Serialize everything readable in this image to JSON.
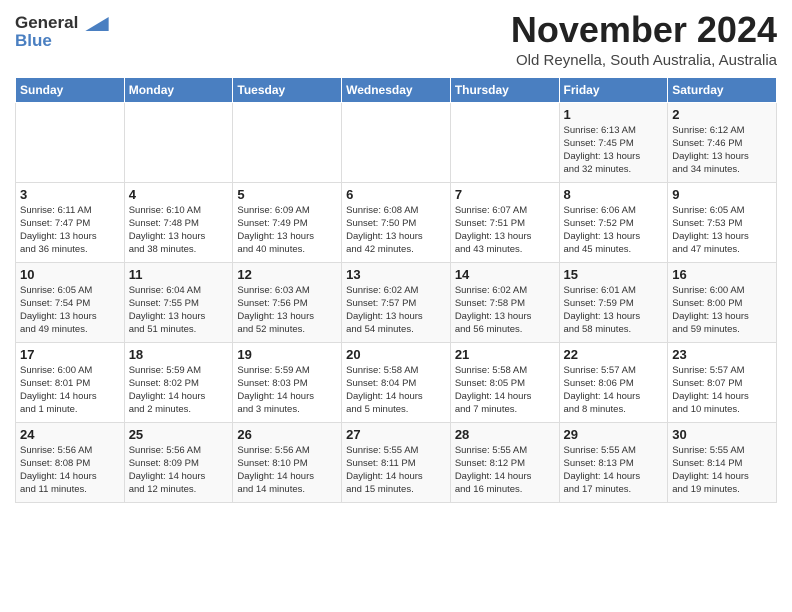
{
  "logo": {
    "line1": "General",
    "line2": "Blue",
    "tagline": ""
  },
  "title": "November 2024",
  "location": "Old Reynella, South Australia, Australia",
  "days_of_week": [
    "Sunday",
    "Monday",
    "Tuesday",
    "Wednesday",
    "Thursday",
    "Friday",
    "Saturday"
  ],
  "weeks": [
    [
      {
        "day": "",
        "info": ""
      },
      {
        "day": "",
        "info": ""
      },
      {
        "day": "",
        "info": ""
      },
      {
        "day": "",
        "info": ""
      },
      {
        "day": "",
        "info": ""
      },
      {
        "day": "1",
        "info": "Sunrise: 6:13 AM\nSunset: 7:45 PM\nDaylight: 13 hours\nand 32 minutes."
      },
      {
        "day": "2",
        "info": "Sunrise: 6:12 AM\nSunset: 7:46 PM\nDaylight: 13 hours\nand 34 minutes."
      }
    ],
    [
      {
        "day": "3",
        "info": "Sunrise: 6:11 AM\nSunset: 7:47 PM\nDaylight: 13 hours\nand 36 minutes."
      },
      {
        "day": "4",
        "info": "Sunrise: 6:10 AM\nSunset: 7:48 PM\nDaylight: 13 hours\nand 38 minutes."
      },
      {
        "day": "5",
        "info": "Sunrise: 6:09 AM\nSunset: 7:49 PM\nDaylight: 13 hours\nand 40 minutes."
      },
      {
        "day": "6",
        "info": "Sunrise: 6:08 AM\nSunset: 7:50 PM\nDaylight: 13 hours\nand 42 minutes."
      },
      {
        "day": "7",
        "info": "Sunrise: 6:07 AM\nSunset: 7:51 PM\nDaylight: 13 hours\nand 43 minutes."
      },
      {
        "day": "8",
        "info": "Sunrise: 6:06 AM\nSunset: 7:52 PM\nDaylight: 13 hours\nand 45 minutes."
      },
      {
        "day": "9",
        "info": "Sunrise: 6:05 AM\nSunset: 7:53 PM\nDaylight: 13 hours\nand 47 minutes."
      }
    ],
    [
      {
        "day": "10",
        "info": "Sunrise: 6:05 AM\nSunset: 7:54 PM\nDaylight: 13 hours\nand 49 minutes."
      },
      {
        "day": "11",
        "info": "Sunrise: 6:04 AM\nSunset: 7:55 PM\nDaylight: 13 hours\nand 51 minutes."
      },
      {
        "day": "12",
        "info": "Sunrise: 6:03 AM\nSunset: 7:56 PM\nDaylight: 13 hours\nand 52 minutes."
      },
      {
        "day": "13",
        "info": "Sunrise: 6:02 AM\nSunset: 7:57 PM\nDaylight: 13 hours\nand 54 minutes."
      },
      {
        "day": "14",
        "info": "Sunrise: 6:02 AM\nSunset: 7:58 PM\nDaylight: 13 hours\nand 56 minutes."
      },
      {
        "day": "15",
        "info": "Sunrise: 6:01 AM\nSunset: 7:59 PM\nDaylight: 13 hours\nand 58 minutes."
      },
      {
        "day": "16",
        "info": "Sunrise: 6:00 AM\nSunset: 8:00 PM\nDaylight: 13 hours\nand 59 minutes."
      }
    ],
    [
      {
        "day": "17",
        "info": "Sunrise: 6:00 AM\nSunset: 8:01 PM\nDaylight: 14 hours\nand 1 minute."
      },
      {
        "day": "18",
        "info": "Sunrise: 5:59 AM\nSunset: 8:02 PM\nDaylight: 14 hours\nand 2 minutes."
      },
      {
        "day": "19",
        "info": "Sunrise: 5:59 AM\nSunset: 8:03 PM\nDaylight: 14 hours\nand 3 minutes."
      },
      {
        "day": "20",
        "info": "Sunrise: 5:58 AM\nSunset: 8:04 PM\nDaylight: 14 hours\nand 5 minutes."
      },
      {
        "day": "21",
        "info": "Sunrise: 5:58 AM\nSunset: 8:05 PM\nDaylight: 14 hours\nand 7 minutes."
      },
      {
        "day": "22",
        "info": "Sunrise: 5:57 AM\nSunset: 8:06 PM\nDaylight: 14 hours\nand 8 minutes."
      },
      {
        "day": "23",
        "info": "Sunrise: 5:57 AM\nSunset: 8:07 PM\nDaylight: 14 hours\nand 10 minutes."
      }
    ],
    [
      {
        "day": "24",
        "info": "Sunrise: 5:56 AM\nSunset: 8:08 PM\nDaylight: 14 hours\nand 11 minutes."
      },
      {
        "day": "25",
        "info": "Sunrise: 5:56 AM\nSunset: 8:09 PM\nDaylight: 14 hours\nand 12 minutes."
      },
      {
        "day": "26",
        "info": "Sunrise: 5:56 AM\nSunset: 8:10 PM\nDaylight: 14 hours\nand 14 minutes."
      },
      {
        "day": "27",
        "info": "Sunrise: 5:55 AM\nSunset: 8:11 PM\nDaylight: 14 hours\nand 15 minutes."
      },
      {
        "day": "28",
        "info": "Sunrise: 5:55 AM\nSunset: 8:12 PM\nDaylight: 14 hours\nand 16 minutes."
      },
      {
        "day": "29",
        "info": "Sunrise: 5:55 AM\nSunset: 8:13 PM\nDaylight: 14 hours\nand 17 minutes."
      },
      {
        "day": "30",
        "info": "Sunrise: 5:55 AM\nSunset: 8:14 PM\nDaylight: 14 hours\nand 19 minutes."
      }
    ]
  ]
}
